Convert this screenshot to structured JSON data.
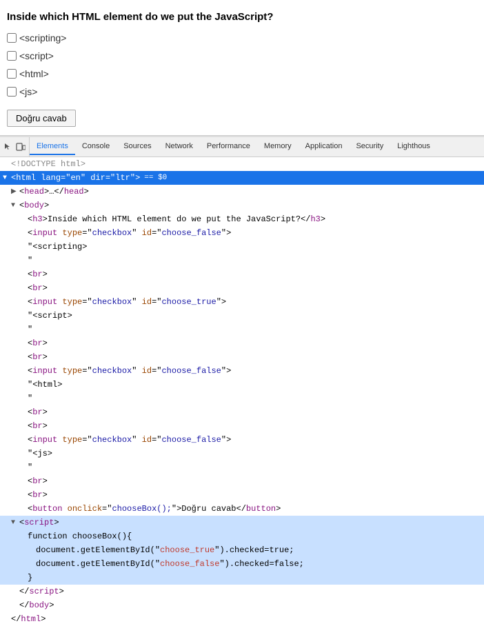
{
  "quiz": {
    "title": "Inside which HTML element do we put the JavaScript?",
    "options": [
      {
        "id": "opt1",
        "label": "<scripting>",
        "checked": false
      },
      {
        "id": "opt2",
        "label": "<script>",
        "checked": false
      },
      {
        "id": "opt3",
        "label": "<html>",
        "checked": false
      },
      {
        "id": "opt4",
        "label": "<js>",
        "checked": false
      }
    ],
    "submit_label": "Doğru cavab"
  },
  "devtools": {
    "tabs": [
      {
        "id": "elements",
        "label": "Elements",
        "active": true
      },
      {
        "id": "console",
        "label": "Console",
        "active": false
      },
      {
        "id": "sources",
        "label": "Sources",
        "active": false
      },
      {
        "id": "network",
        "label": "Network",
        "active": false
      },
      {
        "id": "performance",
        "label": "Performance",
        "active": false
      },
      {
        "id": "memory",
        "label": "Memory",
        "active": false
      },
      {
        "id": "application",
        "label": "Application",
        "active": false
      },
      {
        "id": "security",
        "label": "Security",
        "active": false
      },
      {
        "id": "lighthouse",
        "label": "Lighthous",
        "active": false
      }
    ]
  }
}
